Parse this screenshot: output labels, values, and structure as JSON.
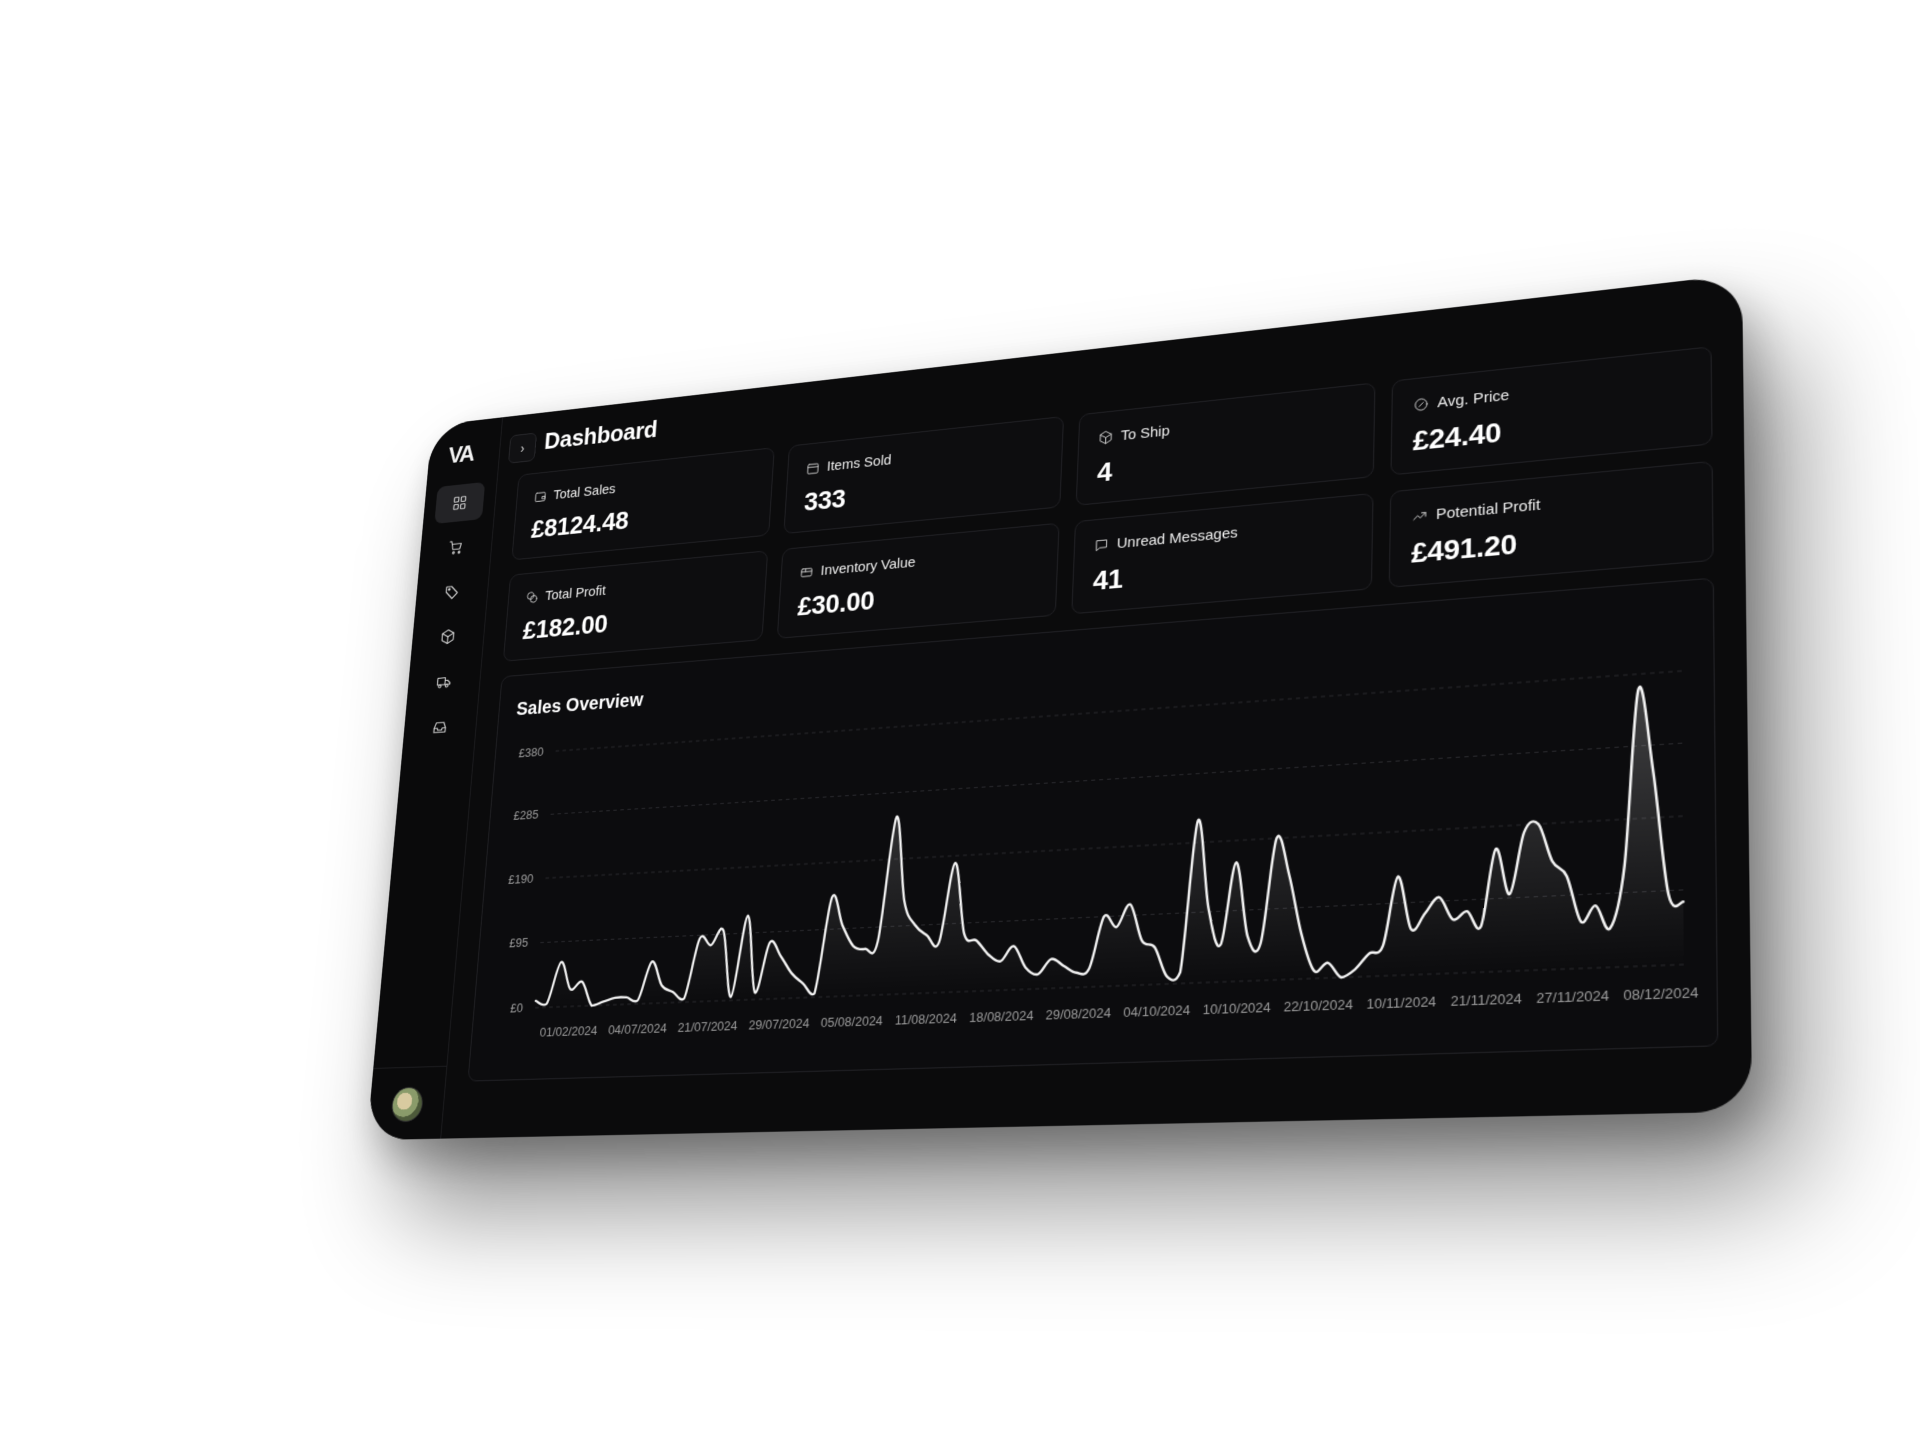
{
  "header": {
    "title": "Dashboard",
    "logo": "VA"
  },
  "sidebar": {
    "items": [
      {
        "icon": "dashboard-grid-icon",
        "active": true
      },
      {
        "icon": "cart-icon"
      },
      {
        "icon": "tag-icon"
      },
      {
        "icon": "box-icon"
      },
      {
        "icon": "truck-icon"
      },
      {
        "icon": "inbox-icon"
      }
    ]
  },
  "stats": [
    {
      "label": "Total Sales",
      "value": "£8124.48",
      "icon": "wallet-icon"
    },
    {
      "label": "Items Sold",
      "value": "333",
      "icon": "calendar-icon"
    },
    {
      "label": "To Ship",
      "value": "4",
      "icon": "package-icon"
    },
    {
      "label": "Avg. Price",
      "value": "£24.40",
      "icon": "badge-icon"
    },
    {
      "label": "Total Profit",
      "value": "£182.00",
      "icon": "coins-icon"
    },
    {
      "label": "Inventory Value",
      "value": "£30.00",
      "icon": "warehouse-icon"
    },
    {
      "label": "Unread Messages",
      "value": "41",
      "icon": "message-icon"
    },
    {
      "label": "Potential Profit",
      "value": "£491.20",
      "icon": "trending-up-icon"
    }
  ],
  "chart": {
    "title": "Sales Overview"
  },
  "chart_data": {
    "type": "area",
    "title": "Sales Overview",
    "yticks": [
      "£0",
      "£95",
      "£190",
      "£285",
      "£380"
    ],
    "ylim": [
      0,
      380
    ],
    "xticks": [
      "01/02/2024",
      "04/07/2024",
      "21/07/2024",
      "29/07/2024",
      "05/08/2024",
      "11/08/2024",
      "18/08/2024",
      "29/08/2024",
      "04/10/2024",
      "10/10/2024",
      "22/10/2024",
      "10/11/2024",
      "21/11/2024",
      "27/11/2024",
      "08/12/2024"
    ],
    "values": [
      10,
      5,
      65,
      25,
      35,
      0,
      5,
      10,
      10,
      5,
      60,
      25,
      15,
      5,
      90,
      80,
      100,
      5,
      120,
      10,
      80,
      60,
      35,
      20,
      5,
      140,
      100,
      70,
      65,
      75,
      250,
      130,
      95,
      80,
      70,
      180,
      80,
      70,
      50,
      40,
      60,
      30,
      20,
      40,
      30,
      20,
      25,
      95,
      80,
      110,
      60,
      50,
      10,
      15,
      220,
      100,
      50,
      160,
      60,
      50,
      190,
      140,
      60,
      10,
      20,
      0,
      10,
      30,
      40,
      130,
      60,
      80,
      100,
      70,
      80,
      60,
      160,
      100,
      180,
      190,
      140,
      120,
      60,
      80,
      50,
      130,
      360,
      250,
      90,
      80
    ]
  }
}
